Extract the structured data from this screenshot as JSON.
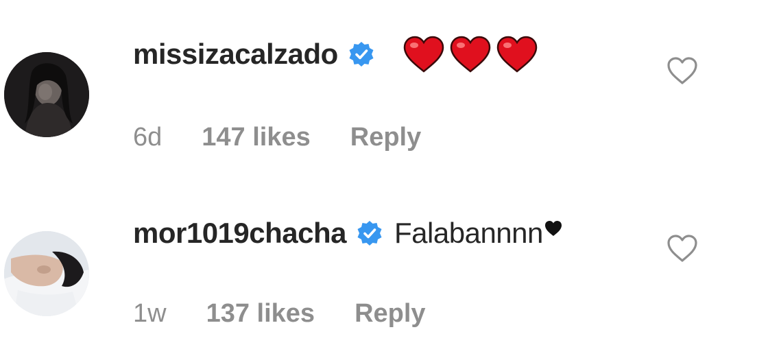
{
  "colors": {
    "text_primary": "#262626",
    "text_secondary": "#8e8e8e",
    "verified_blue": "#3897f0",
    "emoji_red": "#e0101e"
  },
  "comments": [
    {
      "username": "missizacalzado",
      "verified": true,
      "text": "",
      "emoji": [
        "red-heart-emoji",
        "red-heart-emoji",
        "red-heart-emoji"
      ],
      "time": "6d",
      "likes": "147 likes",
      "reply_label": "Reply"
    },
    {
      "username": "mor1019chacha",
      "verified": true,
      "text": "Falabannnn",
      "emoji": [
        "black-heart-emoji"
      ],
      "time": "1w",
      "likes": "137 likes",
      "reply_label": "Reply"
    }
  ],
  "icons": {
    "verified": "verified-badge-icon",
    "like": "heart-outline-icon"
  }
}
